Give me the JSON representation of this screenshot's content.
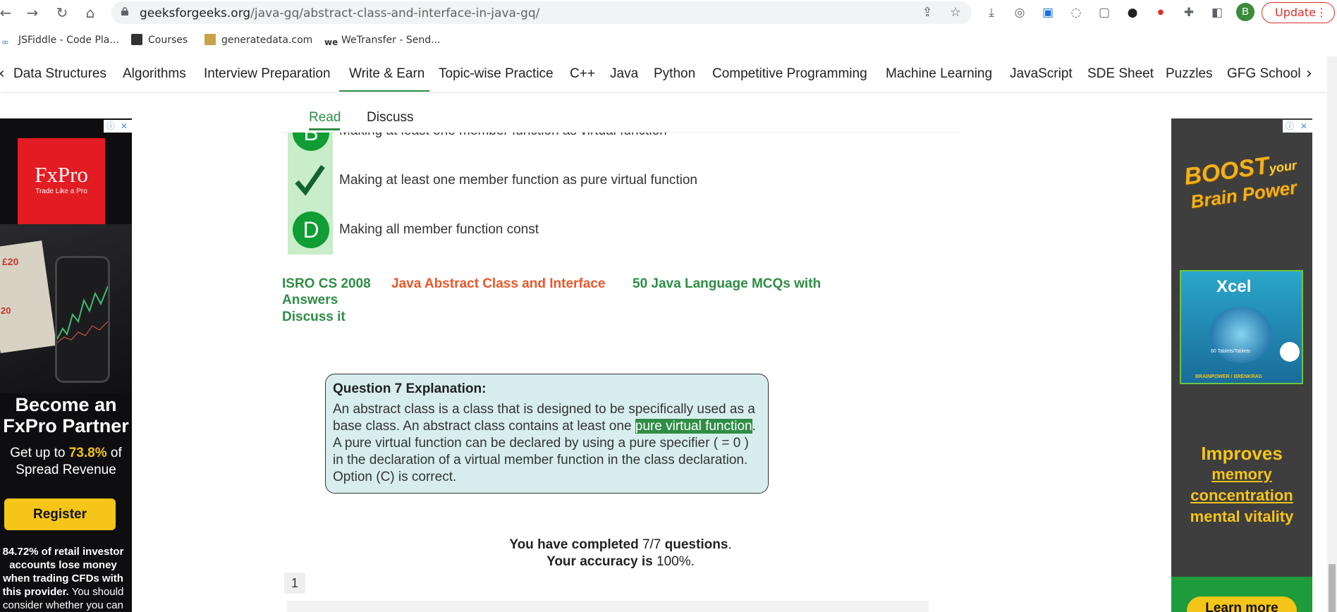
{
  "browser": {
    "url_host": "geeksforgeeks.org",
    "url_path": "/java-gq/abstract-class-and-interface-in-java-gq/",
    "avatar_letter": "B",
    "update_label": "Update"
  },
  "bookmarks": [
    {
      "label": "JSFiddle - Code Pla..."
    },
    {
      "label": "Courses"
    },
    {
      "label": "generatedata.com"
    },
    {
      "label": "WeTransfer - Send..."
    }
  ],
  "nav": {
    "items": [
      "Data Structures",
      "Algorithms",
      "Interview Preparation",
      "Write & Earn",
      "Topic-wise Practice",
      "C++",
      "Java",
      "Python",
      "Competitive Programming",
      "Machine Learning",
      "JavaScript",
      "SDE Sheet",
      "Puzzles",
      "GFG School"
    ],
    "active": "Write & Earn",
    "accent": "#2f8d46"
  },
  "article_tabs": {
    "read": "Read",
    "discuss": "Discuss"
  },
  "options": [
    {
      "marker": "B",
      "text": "Making at least one member function as virtual function"
    },
    {
      "marker": "check-icon",
      "text": "Making at least one member function as pure virtual function"
    },
    {
      "marker": "D",
      "text": "Making all member function const"
    }
  ],
  "tags": {
    "isro": "ISRO CS 2008",
    "topic": "Java Abstract Class and Interface",
    "mcq_line1": "50 Java Language MCQs with",
    "mcq_line2": "Answers",
    "discuss": "Discuss it"
  },
  "explanation": {
    "title": "Question 7 Explanation:",
    "before": "An abstract class is a class that is designed to be specifically used as a base class. An abstract class contains at least one ",
    "highlight": "pure virtual function",
    "after": ". A pure virtual function can be declared by using a pure specifier ( = 0 ) in the declaration of a virtual member function in the class declaration. Option (C) is correct."
  },
  "result": {
    "completed_prefix": "You have completed",
    "completed_value": "7/7",
    "completed_suffix": "questions",
    "accuracy_prefix": "Your accuracy is",
    "accuracy_value": "100%"
  },
  "pagination": {
    "current": "1"
  },
  "ad_left": {
    "brand": "FxPro",
    "tagline": "Trade Like a Pro",
    "headline1": "Become an",
    "headline2": "FxPro Partner",
    "offer_prefix": "Get up to",
    "offer_value": "73.8%",
    "offer_suffix": "of",
    "offer_line2": "Spread Revenue",
    "cta": "Register",
    "disclaimer_bold": "84.72% of retail investor accounts lose money when trading CFDs with this provider.",
    "disclaimer_rest": "You should consider whether you can",
    "price1": "£20",
    "price2": "20"
  },
  "ad_right": {
    "headline1": "BOOST",
    "headline_your": "your",
    "headline2": "Brain Power",
    "product": "Xcel",
    "pack_small": "60 Tablets/Tablets",
    "pack_bottom": "BRAINPOWER / BRENKRAG",
    "line1": "Improves",
    "line2": "memory",
    "line3": "concentration",
    "line4": "mental vitality",
    "cta": "Learn more"
  }
}
